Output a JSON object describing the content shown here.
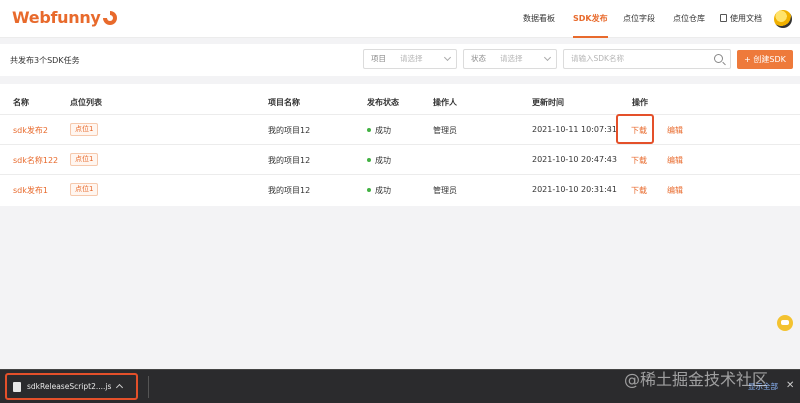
{
  "app": {
    "logo_text": "Webfunny"
  },
  "nav": {
    "items": [
      {
        "label": "数据看板"
      },
      {
        "label": "SDK发布"
      },
      {
        "label": "点位字段"
      },
      {
        "label": "点位仓库"
      },
      {
        "label": "使用文档"
      }
    ],
    "active": "SDK发布"
  },
  "toolbar": {
    "summary": "共发布3个SDK任务",
    "project_filter": {
      "label": "项目",
      "placeholder": "请选择"
    },
    "status_filter": {
      "label": "状态",
      "placeholder": "请选择"
    },
    "search": {
      "placeholder": "请输入SDK名称"
    },
    "create_button": "+ 创建SDK"
  },
  "table": {
    "columns": [
      "名称",
      "点位列表",
      "项目名称",
      "发布状态",
      "操作人",
      "更新时间",
      "操作"
    ],
    "rows": [
      {
        "name": "sdk发布2",
        "points": "点位1",
        "project": "我的项目12",
        "status": "成功",
        "operator": "管理员",
        "updated": "2021-10-11 10:07:31",
        "download": "下载",
        "edit": "编辑"
      },
      {
        "name": "sdk名称122",
        "points": "点位1",
        "project": "我的项目12",
        "status": "成功",
        "operator": "",
        "updated": "2021-10-10 20:47:43",
        "download": "下载",
        "edit": "编辑"
      },
      {
        "name": "sdk发布1",
        "points": "点位1",
        "project": "我的项目12",
        "status": "成功",
        "operator": "管理员",
        "updated": "2021-10-10 20:31:41",
        "download": "下载",
        "edit": "编辑"
      }
    ]
  },
  "download_bar": {
    "file_name": "sdkReleaseScript2....js",
    "show_all": "显示全部",
    "close": "✕"
  },
  "watermark": "@稀土掘金技术社区",
  "colors": {
    "accent": "#e86a2c",
    "success": "#43b244",
    "highlight": "#e4502a"
  }
}
